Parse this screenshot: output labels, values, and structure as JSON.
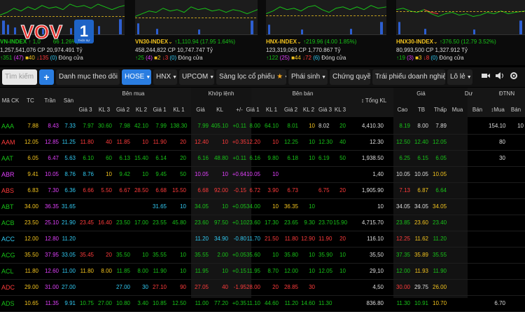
{
  "indices": [
    {
      "name": "VN-INDEX",
      "arrow": "up",
      "price": "1,0",
      "change": "66 1.26%)",
      "vol": "1,257,541,076",
      "cp_label": "CP",
      "value": "20,974.491",
      "unit": "Tỷ",
      "up_count": "351",
      "up_ce": "(47)",
      "ref_count": "40",
      "down_count": "135",
      "floor": "(0)",
      "status": "Đóng cửa"
    },
    {
      "name": "VN30-INDEX",
      "arrow": "down",
      "price": "1,110.94",
      "change": "(17.95 1.64%)",
      "vol": "458,244,822",
      "cp_label": "CP",
      "value": "10,747.747",
      "unit": "Tỷ",
      "up_count": "25",
      "up_ce": "(4)",
      "ref_count": "2",
      "down_count": "3",
      "floor": "(0)",
      "status": "Đóng cửa"
    },
    {
      "name": "HNX-INDEX",
      "arrow": "down",
      "price": "219.96",
      "change": "(4.00 1.85%)",
      "vol": "123,319,063",
      "cp_label": "CP",
      "value": "1,770.867",
      "unit": "Tỷ",
      "up_count": "122",
      "up_ce": "(25)",
      "ref_count": "44",
      "down_count": "72",
      "floor": "(6)",
      "status": "Đóng cửa"
    },
    {
      "name": "HNX30-INDEX",
      "arrow": "down",
      "price": "376.50",
      "change": "(12.79 3.52%)",
      "vol": "80,993,500",
      "cp_label": "CP",
      "value": "1,327.912",
      "unit": "Tỷ",
      "up_count": "19",
      "up_ce": "(3)",
      "ref_count": "3",
      "down_count": "8",
      "floor": "(0)",
      "status": "Đóng cửa"
    }
  ],
  "logo": {
    "text": "VOV",
    "badge": "1",
    "badge_sub": "THỜI SỰ"
  },
  "toolbar": {
    "search_placeholder": "Tìm kiếm",
    "plus": "+",
    "watchlist": "Danh mục theo dõi",
    "hose": "HOSE",
    "hnx": "HNX",
    "upcom": "UPCOM",
    "screener": "Sàng lọc cổ phiếu",
    "derivatives": "Phái sinh",
    "warrants": "Chứng quyền",
    "bonds": "Trái phiếu doanh nghiệp",
    "oddlot": "Lô lẻ"
  },
  "groups": {
    "buy": "Bên mua",
    "match": "Khớp lệnh",
    "sell": "Bên bán",
    "total": "Tổng KL",
    "price": "Giá",
    "remain": "Dư",
    "foreign": "ĐTNN"
  },
  "columns": [
    "Mã CK",
    "TC",
    "Trần",
    "Sàn",
    "Giá 3",
    "KL 3",
    "Giá 2",
    "KL 2",
    "Giá 1",
    "KL 1",
    "Giá",
    "KL",
    "+/-",
    "Giá 1",
    "KL 1",
    "Giá 2",
    "KL 2",
    "Giá 3",
    "KL 3",
    "Tổng KL",
    "Cao",
    "TB",
    "Thấp",
    "Mua",
    "Bán",
    "Mua",
    "Bán"
  ],
  "rows": [
    {
      "c": [
        "AAA",
        "7.88",
        "8.43",
        "7.33",
        "7.97",
        "30.60",
        "7.98",
        "42.10",
        "7.99",
        "138.30",
        "7.99",
        "405.10",
        "+0.11",
        "8.00",
        "64.10",
        "8.01",
        "10",
        "8.02",
        "20",
        "4,410.30",
        "8.19",
        "8.00",
        "7.89",
        "",
        "",
        "154.10",
        "10"
      ],
      "k": "uuuuuuuuuuuuuuuuw-uuu---w"
    },
    {
      "c": [
        "AAM",
        "12.05",
        "12.85",
        "11.25",
        "11.80",
        "40",
        "11.85",
        "10",
        "11.90",
        "20",
        "12.40",
        "10",
        "+0.35",
        "12.20",
        "10",
        "12.25",
        "10",
        "12.30",
        "40",
        "12.30",
        "12.50",
        "12.40",
        "12.05",
        "",
        "",
        "80",
        ""
      ],
      "k": "wrceddddddddddduuuuuuuuuw--w-"
    },
    {
      "c": [
        "AAT",
        "6.05",
        "6.47",
        "5.63",
        "6.10",
        "60",
        "6.13",
        "15.40",
        "6.14",
        "20",
        "6.16",
        "48.80",
        "+0.11",
        "6.16",
        "9.80",
        "6.18",
        "10",
        "6.19",
        "50",
        "1,938.50",
        "6.25",
        "6.15",
        "6.05",
        "",
        "",
        "30",
        ""
      ],
      "k": "wrceuuuuuuuuuuuuuuuuuuuwuur--w-"
    },
    {
      "c": [
        "ABR",
        "9.41",
        "10.05",
        "8.76",
        "8.76",
        "10",
        "9.42",
        "10",
        "9.45",
        "50",
        "10.05",
        "10",
        "+0.64",
        "10.05",
        "10",
        "",
        "",
        "",
        "",
        "1,40",
        "10.05",
        "10.05",
        "10.05",
        "",
        "",
        "",
        ""
      ],
      "k": "wrcefwuuuuccccccc-----wccc----"
    },
    {
      "c": [
        "ABS",
        "6.83",
        "7.30",
        "6.36",
        "6.66",
        "5.50",
        "6.67",
        "28.50",
        "6.68",
        "15.50",
        "6.68",
        "92.00",
        "-0.15",
        "6.72",
        "3.90",
        "6.73",
        "",
        "6.75",
        "20",
        "1,905.90",
        "7.13",
        "6.87",
        "6.64",
        "",
        "",
        "",
        ""
      ],
      "k": "wrcedddddddddddddddddwuuu----"
    },
    {
      "c": [
        "ABT",
        "34.00",
        "36.35",
        "31.65",
        "",
        "",
        "",
        "",
        "31.65",
        "10",
        "34.05",
        "10",
        "+0.05",
        "34.00",
        "10",
        "36.35",
        "10",
        "",
        "",
        "10",
        "34.05",
        "34.05",
        "34.05",
        "",
        "",
        "",
        ""
      ],
      "k": "wrce----ffuuuuwwuc----wuuu----"
    },
    {
      "c": [
        "ACB",
        "23.50",
        "25.10",
        "21.90",
        "23.45",
        "16.40",
        "23.50",
        "17.00",
        "23.55",
        "45.80",
        "23.60",
        "97.50",
        "+0.10",
        "23.60",
        "17.30",
        "23.65",
        "9.30",
        "23.70",
        "15.90",
        "4,715.70",
        "23.85",
        "23.60",
        "23.40",
        "",
        "",
        "",
        ""
      ],
      "k": "wrcedduuuuuuuuuuuuuuuwuuu----"
    },
    {
      "c": [
        "ACC",
        "12.00",
        "12.80",
        "11.20",
        "",
        "",
        "",
        "",
        "",
        "",
        "11.20",
        "34.90",
        "-0.80",
        "11.70",
        "21.50",
        "11.80",
        "12.90",
        "11.90",
        "20",
        "116.10",
        "12.25",
        "11.62",
        "11.20",
        "",
        "",
        "",
        ""
      ],
      "k": "wrce------ffffdddddddwudf----"
    },
    {
      "c": [
        "ACG",
        "35.50",
        "37.95",
        "33.05",
        "35.45",
        "20",
        "35.50",
        "10",
        "35.55",
        "10",
        "35.55",
        "2.00",
        "+0.05",
        "35.60",
        "10",
        "35.80",
        "10",
        "35.90",
        "10",
        "35,50",
        "37.35",
        "35.89",
        "35.55",
        "",
        "",
        "",
        ""
      ],
      "k": "wrcedduuuuuuuuuuuuuuuwuuu----"
    },
    {
      "c": [
        "ACL",
        "11.80",
        "12.60",
        "11.00",
        "11.80",
        "8.00",
        "11.85",
        "8.00",
        "11.90",
        "10",
        "11.95",
        "10",
        "+0.15",
        "11.95",
        "8.70",
        "12.00",
        "10",
        "12.05",
        "10",
        "29,10",
        "12.00",
        "11.93",
        "11.90",
        "",
        "",
        "",
        ""
      ],
      "k": "wrcewwuuuuuuuuuuuuuuuwuuu----"
    },
    {
      "c": [
        "ADC",
        "29.00",
        "31.00",
        "27.00",
        "",
        "",
        "27.00",
        "30",
        "27.10",
        "90",
        "27.05",
        "40",
        "-1.95",
        "28.00",
        "20",
        "28.85",
        "30",
        "",
        "",
        "4,50",
        "30.00",
        "29.75",
        "26.00",
        "",
        "",
        "",
        ""
      ],
      "k": "wrce--ffddddddddddddd-wuud----"
    },
    {
      "c": [
        "ADS",
        "10.65",
        "11.35",
        "9.91",
        "10.75",
        "27.00",
        "10.80",
        "3.40",
        "10.85",
        "12.50",
        "11.00",
        "77.20",
        "+0.35",
        "11.10",
        "44.60",
        "11.20",
        "14.60",
        "11.30",
        "",
        "836.80",
        "11.30",
        "10.91",
        "10.70",
        "",
        "",
        "6.70",
        ""
      ],
      "k": "wrceuuuuuuuuuuuuuuuuuuwuuu--w-"
    }
  ]
}
